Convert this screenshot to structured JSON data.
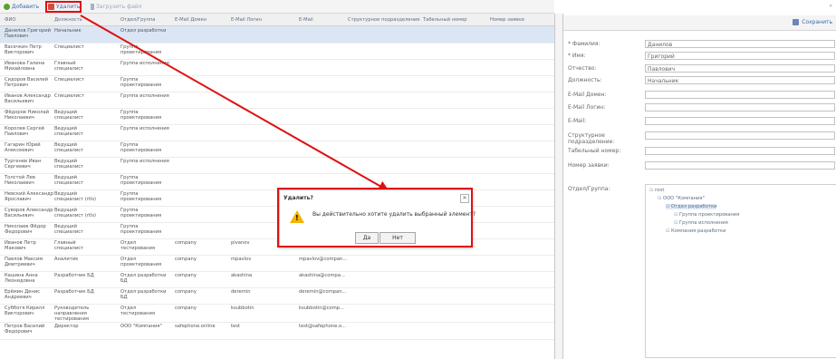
{
  "toolbar": {
    "add_label": "Добавить",
    "delete_label": "Удалить",
    "upload_label": "Загрузить файл"
  },
  "grid": {
    "columns": [
      "ФИО",
      "Должность",
      "Отдел/Группа",
      "E-Mail Домен",
      "E-Mail Логин",
      "E-Mail",
      "Структурное подразделение",
      "Табельный номер",
      "Номер заявки"
    ],
    "rows": [
      {
        "fio": [
          "Данилов Григорий",
          "Павлович"
        ],
        "pos": [
          "Начальник"
        ],
        "dept": [
          "Отдел разработки"
        ],
        "domain": "",
        "login": "",
        "email": "",
        "selected": true
      },
      {
        "fio": [
          "Васечкин Петр",
          "Викторович"
        ],
        "pos": [
          "Специалист"
        ],
        "dept": [
          "Группа",
          "проектирования"
        ],
        "domain": "",
        "login": "",
        "email": ""
      },
      {
        "fio": [
          "Иванова Галина",
          "Михайловна"
        ],
        "pos": [
          "Главный",
          "специалист"
        ],
        "dept": [
          "Группа исполнения"
        ],
        "domain": "",
        "login": "",
        "email": ""
      },
      {
        "fio": [
          "Сидоров Василий",
          "Петрович"
        ],
        "pos": [
          "Специалист"
        ],
        "dept": [
          "Группа",
          "проектирования"
        ],
        "domain": "",
        "login": "",
        "email": ""
      },
      {
        "fio": [
          "Иванов Александр",
          "Васильевич"
        ],
        "pos": [
          "Специалист"
        ],
        "dept": [
          "Группа исполнения"
        ],
        "domain": "",
        "login": "",
        "email": ""
      },
      {
        "fio": [
          "Фёдоров Николай",
          "Николаевич"
        ],
        "pos": [
          "Ведущий",
          "специалист"
        ],
        "dept": [
          "Группа",
          "проектирования"
        ],
        "domain": "",
        "login": "",
        "email": ""
      },
      {
        "fio": [
          "Королев Сергей",
          "Павлович"
        ],
        "pos": [
          "Ведущий",
          "специалист"
        ],
        "dept": [
          "Группа исполнения"
        ],
        "domain": "",
        "login": "",
        "email": ""
      },
      {
        "fio": [
          "Гагарин Юрий",
          "Алексеевич"
        ],
        "pos": [
          "Ведущий",
          "специалист"
        ],
        "dept": [
          "Группа",
          "проектирования"
        ],
        "domain": "",
        "login": "",
        "email": ""
      },
      {
        "fio": [
          "Тургенев Иван",
          "Сергеевич"
        ],
        "pos": [
          "Ведущий",
          "специалист"
        ],
        "dept": [
          "Группа исполнения"
        ],
        "domain": "",
        "login": "",
        "email": ""
      },
      {
        "fio": [
          "Толстой Лев",
          "Николаевич"
        ],
        "pos": [
          "Ведущий",
          "специалист"
        ],
        "dept": [
          "Группа",
          "проектирования"
        ],
        "domain": "",
        "login": "",
        "email": ""
      },
      {
        "fio": [
          "Невский Александр",
          "Ярославич"
        ],
        "pos": [
          "Ведущий",
          "специалист (rtls)"
        ],
        "dept": [
          "Группа",
          "проектирования"
        ],
        "domain": "",
        "login": "",
        "email": ""
      },
      {
        "fio": [
          "Суворов Александр",
          "Васильевич"
        ],
        "pos": [
          "Ведущий",
          "специалист (rtls)"
        ],
        "dept": [
          "Группа",
          "проектирования"
        ],
        "domain": "",
        "login": "",
        "email": ""
      },
      {
        "fio": [
          "Николаев Фёдор",
          "Федорович"
        ],
        "pos": [
          "Ведущий",
          "специалист"
        ],
        "dept": [
          "Группа",
          "проектирования"
        ],
        "domain": "",
        "login": "",
        "email": ""
      },
      {
        "fio": [
          "Иванов Петр",
          "Макович"
        ],
        "pos": [
          "Главный",
          "специалист"
        ],
        "dept": [
          "Отдел",
          "тестирования"
        ],
        "domain": "company",
        "login": "pivanov",
        "email": "pivanov@compan..."
      },
      {
        "fio": [
          "Павлов Максим",
          "Дмитриевич"
        ],
        "pos": [
          "Аналитик"
        ],
        "dept": [
          "Отдел",
          "проектирования"
        ],
        "domain": "company",
        "login": "mpavlov",
        "email": "mpavlov@compan..."
      },
      {
        "fio": [
          "Кашина Анна",
          "Леонидовна"
        ],
        "pos": [
          "Разработчик БД"
        ],
        "dept": [
          "Отдел разработки",
          "БД"
        ],
        "domain": "company",
        "login": "akashina",
        "email": "akashina@compa..."
      },
      {
        "fio": [
          "Ерёмин Денис",
          "Андреевич"
        ],
        "pos": [
          "Разработчик БД"
        ],
        "dept": [
          "Отдел разработки",
          "БД"
        ],
        "domain": "company",
        "login": "deremin",
        "email": "deremin@compan..."
      },
      {
        "fio": [
          "Субботя Кирилл",
          "Викторович"
        ],
        "pos": [
          "Руководитель",
          "направления",
          "тестирования"
        ],
        "dept": [
          "Отдел",
          "тестирования"
        ],
        "domain": "company",
        "login": "ksubbotin",
        "email": "ksubbotin@comp..."
      },
      {
        "fio": [
          "Петров Василий",
          "Федорович"
        ],
        "pos": [
          "Директор"
        ],
        "dept": [
          "ООО \"Компания\""
        ],
        "domain": "safephone.online",
        "login": "test",
        "email": "test@safephone.o..."
      }
    ]
  },
  "form": {
    "save_label": "Сохранить",
    "fields": [
      {
        "label": "* Фамилия:",
        "value": "Данилов"
      },
      {
        "label": "* Имя:",
        "value": "Григорий"
      },
      {
        "label": "Отчество:",
        "value": "Павлович"
      },
      {
        "label": "Должность:",
        "value": "Начальник"
      },
      {
        "label": "E-Mail Домен:",
        "value": ""
      },
      {
        "label": "E-Mail Логин:",
        "value": ""
      },
      {
        "label": "E-Mail:",
        "value": ""
      },
      {
        "label": "Структурное подразделение:",
        "value": ""
      },
      {
        "label": "Табельный номер:",
        "value": ""
      },
      {
        "label": "Номер заявки:",
        "value": ""
      }
    ],
    "dept_label": "Отдел/Группа:",
    "tree": [
      {
        "label": "root",
        "level": 0
      },
      {
        "label": "ООО \"Компания\"",
        "level": 1
      },
      {
        "label": "Отдел разработки",
        "level": 2,
        "selected": true
      },
      {
        "label": "Группа проектирования",
        "level": 3
      },
      {
        "label": "Группа исполнения",
        "level": 3
      },
      {
        "label": "Компания разработки",
        "level": 2
      }
    ]
  },
  "dialog": {
    "title": "Удалить?",
    "message": "Вы действительно хотите удалить выбранный элемент?",
    "yes_label": "Да",
    "no_label": "Нет",
    "close_label": "✕"
  },
  "colors": {
    "highlight": "#e01010",
    "warning": "#f4b400",
    "selected_row": "#dbe6f4",
    "link": "#3a6ab0"
  }
}
